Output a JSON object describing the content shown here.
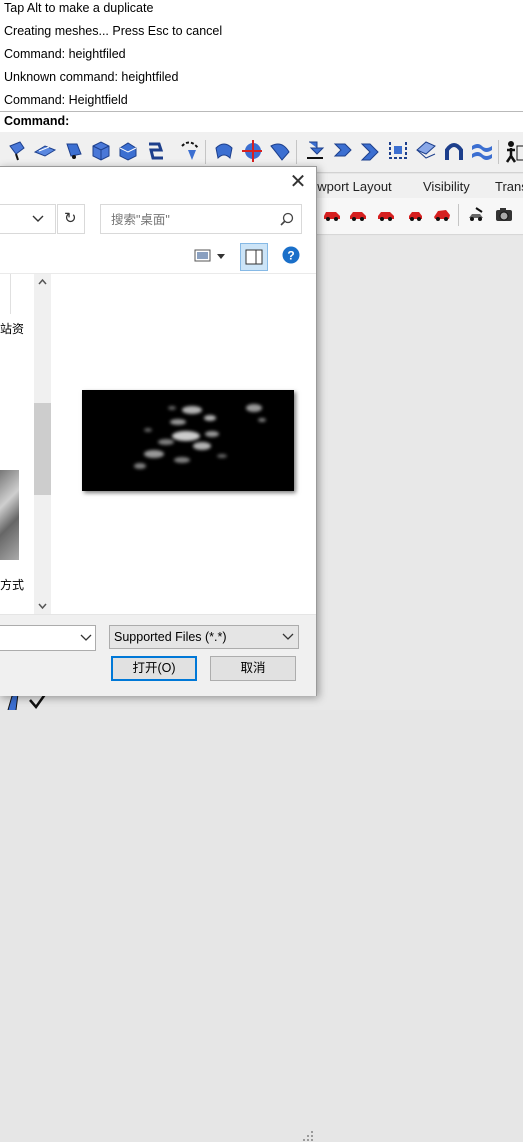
{
  "command_history": [
    "Tap Alt to make a duplicate",
    "Creating meshes... Press Esc to cancel",
    "Command: heightfiled",
    "Unknown command: heightfiled",
    "Command: Heightfield"
  ],
  "command_prompt": "Command:",
  "tabs": [
    "ewport Layout",
    "Visibility",
    "Trans"
  ],
  "dialog": {
    "close_glyph": "✕",
    "search_placeholder": "搜索\"桌面\"",
    "nav_text": [
      "站资",
      "方式"
    ],
    "file_type": "Supported Files (*.*)",
    "open_button": "打开(O)",
    "cancel_button": "取消"
  },
  "colors": {
    "accent": "#0078d7",
    "help": "#1a6fc9",
    "toolbar_blue": "#3c6fd1",
    "car_red": "#d62020"
  },
  "icons": {
    "refresh": "↻",
    "search": "search-icon",
    "help": "?"
  }
}
